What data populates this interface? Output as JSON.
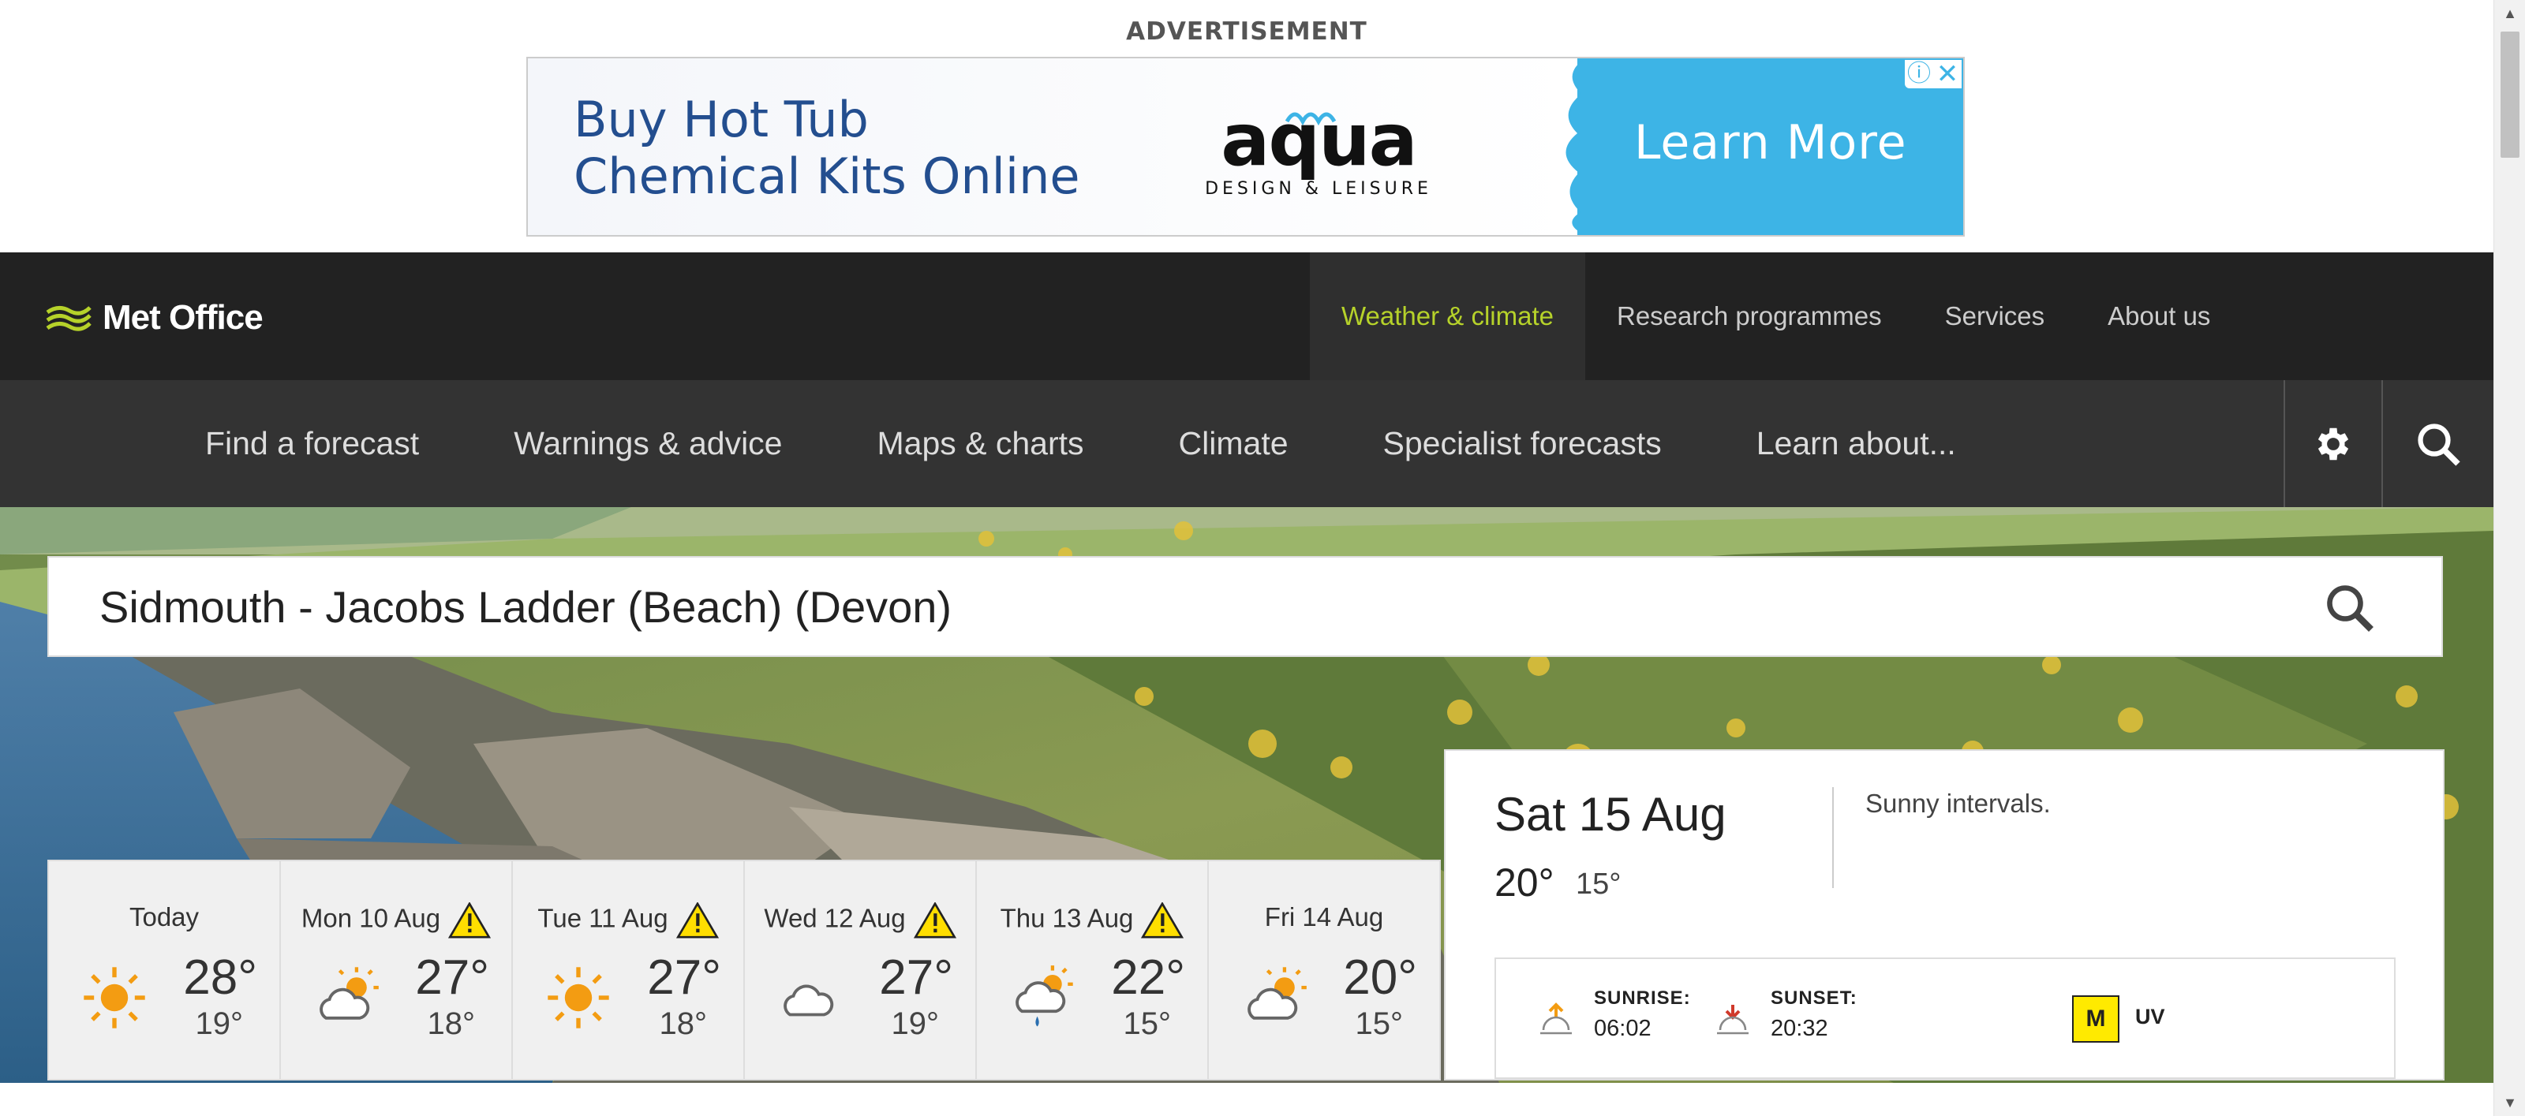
{
  "ad": {
    "label": "ADVERTISEMENT",
    "text_line1": "Buy Hot Tub",
    "text_line2": "Chemical Kits Online",
    "brand_logo": "aqua",
    "brand_tagline": "DESIGN & LEISURE",
    "cta": "Learn More"
  },
  "header": {
    "logo_text": "Met Office",
    "top_nav": [
      {
        "label": "Weather & climate",
        "active": true
      },
      {
        "label": "Research programmes"
      },
      {
        "label": "Services"
      },
      {
        "label": "About us"
      }
    ],
    "sub_nav": [
      {
        "label": "Find a forecast"
      },
      {
        "label": "Warnings & advice"
      },
      {
        "label": "Maps & charts"
      },
      {
        "label": "Climate"
      },
      {
        "label": "Specialist forecasts"
      },
      {
        "label": "Learn about..."
      }
    ],
    "icons": [
      "gear-icon",
      "search-icon"
    ]
  },
  "search": {
    "location": "Sidmouth - Jacobs Ladder (Beach) (Devon)"
  },
  "days": [
    {
      "label": "Today",
      "icon": "sun-icon",
      "warning": false,
      "high": "28°",
      "low": "19°"
    },
    {
      "label": "Mon 10 Aug",
      "icon": "sunny-intervals-icon",
      "warning": true,
      "high": "27°",
      "low": "18°"
    },
    {
      "label": "Tue 11 Aug",
      "icon": "sun-icon",
      "warning": true,
      "high": "27°",
      "low": "18°"
    },
    {
      "label": "Wed 12 Aug",
      "icon": "cloud-icon",
      "warning": true,
      "high": "27°",
      "low": "19°"
    },
    {
      "label": "Thu 13 Aug",
      "icon": "light-shower-icon",
      "warning": true,
      "high": "22°",
      "low": "15°"
    },
    {
      "label": "Fri 14 Aug",
      "icon": "sunny-intervals-icon",
      "warning": false,
      "high": "20°",
      "low": "15°"
    }
  ],
  "detail": {
    "date": "Sat 15 Aug",
    "high": "20°",
    "low": "15°",
    "summary": "Sunny intervals.",
    "sunrise_label": "SUNRISE:",
    "sunrise": "06:02",
    "sunset_label": "SUNSET:",
    "sunset": "20:32",
    "uv_value": "M",
    "uv_label": "UV"
  },
  "colors": {
    "header_bg": "#222222",
    "subnav_bg": "#333333",
    "accent": "#b6d22a",
    "ad_blue": "#3db4e6",
    "warning_yellow": "#ffde00",
    "sun_orange": "#f39c12"
  }
}
